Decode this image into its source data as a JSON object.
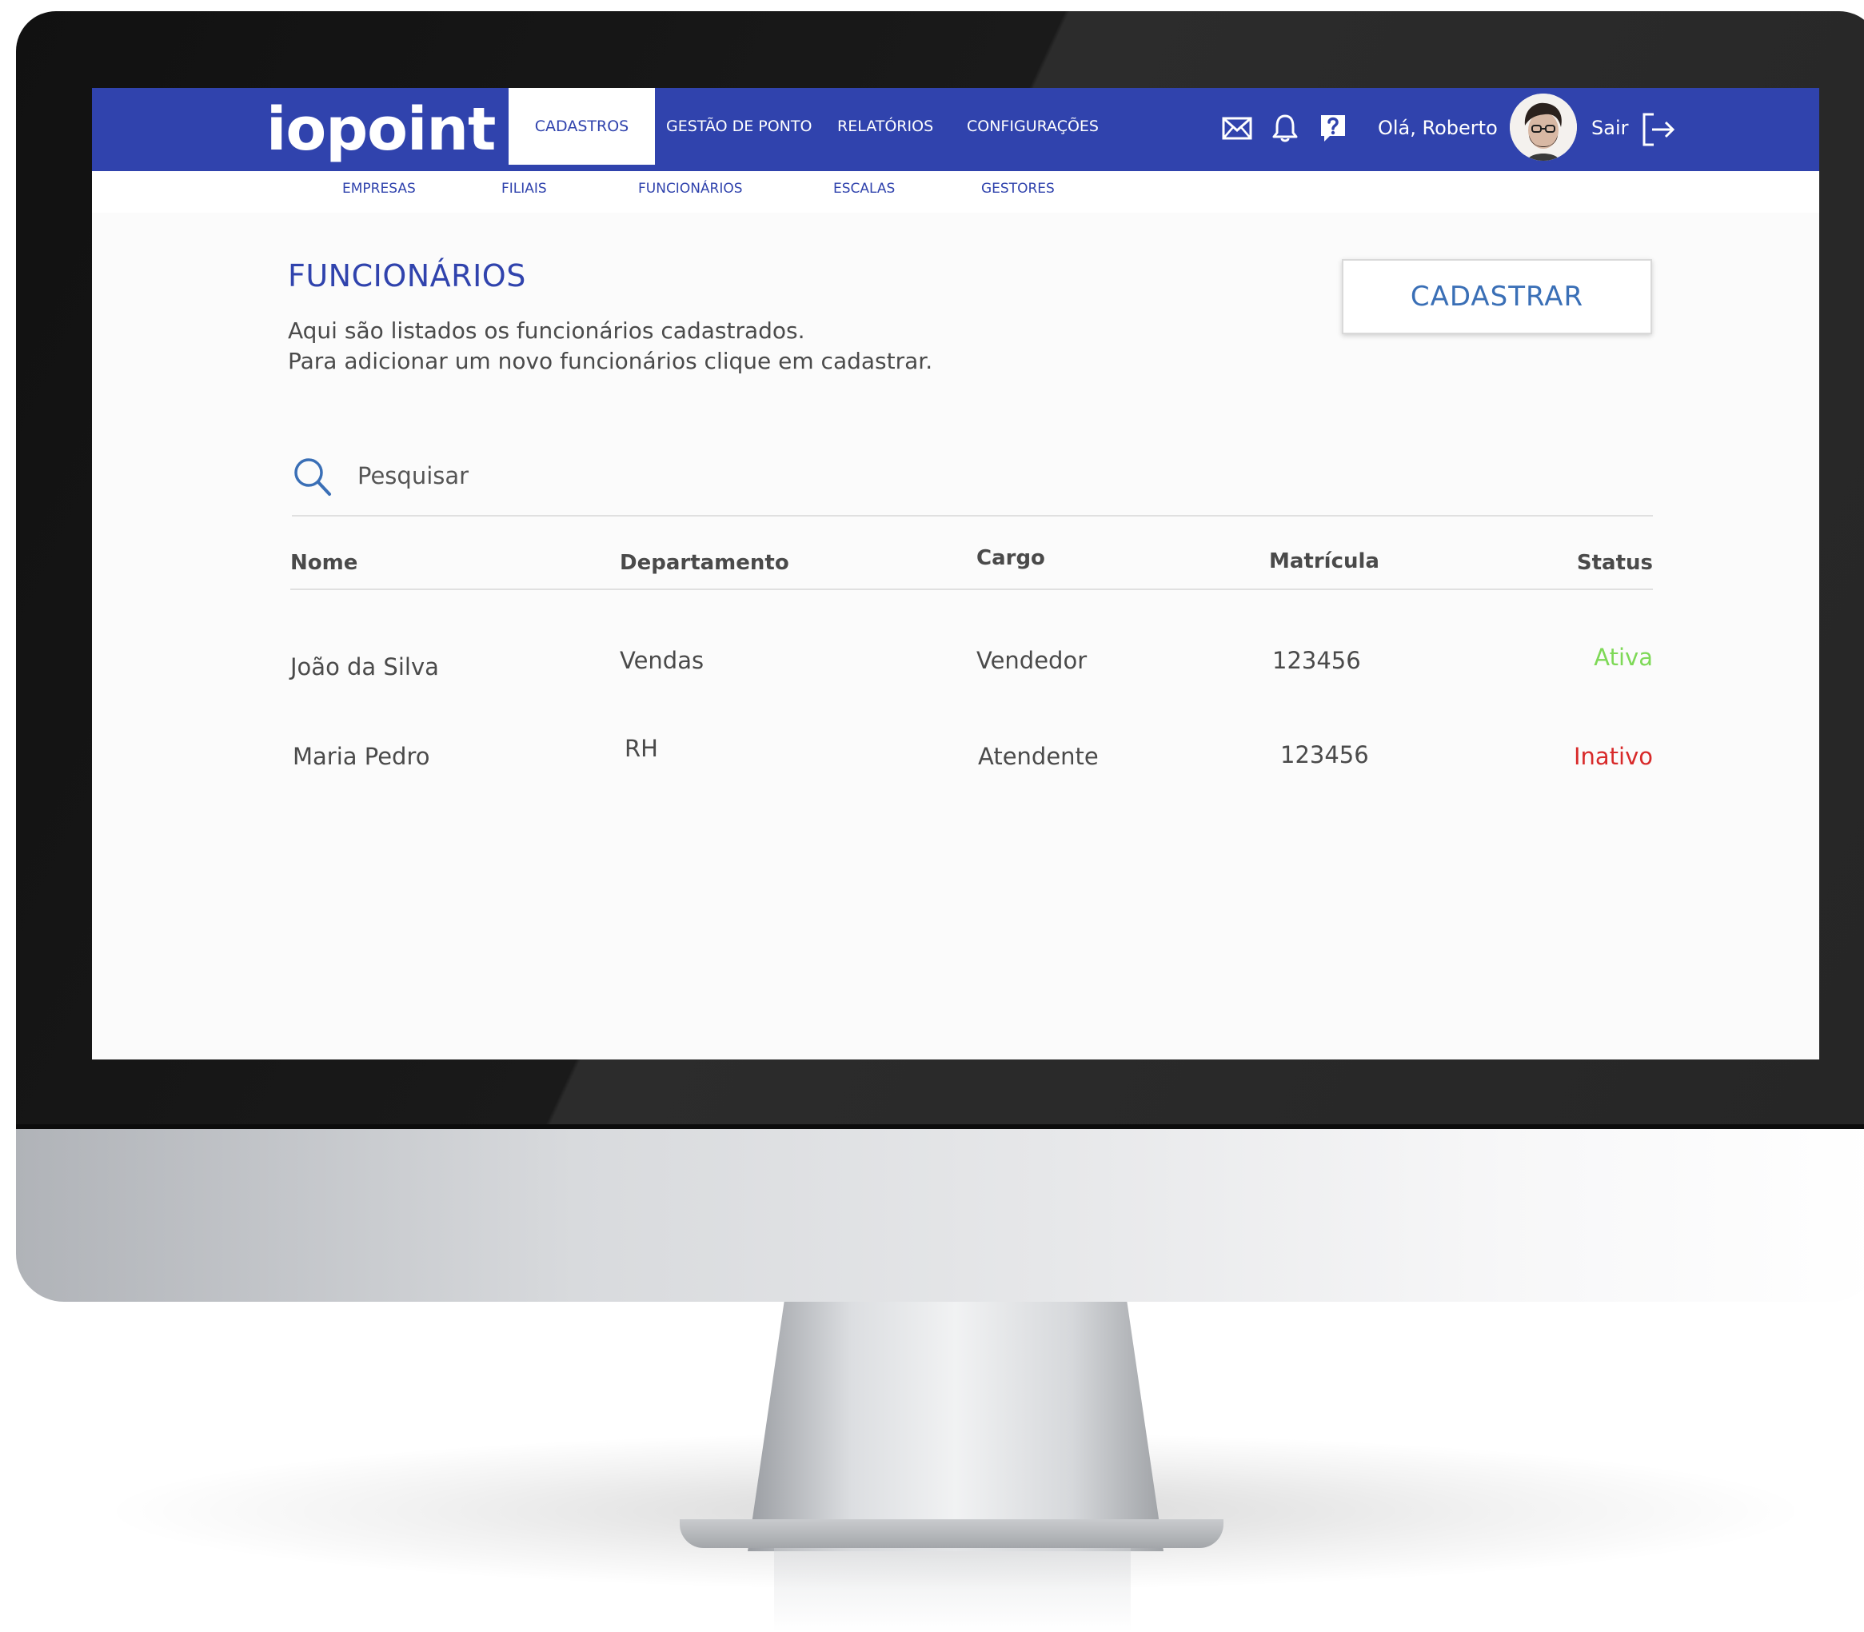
{
  "app": {
    "logo": "iopoint"
  },
  "nav": {
    "items": [
      {
        "label": "CADASTROS",
        "active": true
      },
      {
        "label": "GESTÃO DE PONTO",
        "active": false
      },
      {
        "label": "RELATÓRIOS",
        "active": false
      },
      {
        "label": "CONFIGURAÇÕES",
        "active": false
      }
    ]
  },
  "toolbar": {
    "icons": [
      "mail-icon",
      "bell-icon",
      "help-icon"
    ],
    "greeting": "Olá, Roberto",
    "logout_label": "Sair"
  },
  "subnav": {
    "items": [
      "EMPRESAS",
      "FILIAIS",
      "FUNCIONÁRIOS",
      "ESCALAS",
      "GESTORES"
    ]
  },
  "page": {
    "title": "FUNCIONÁRIOS",
    "description_line1": "Aqui são listados os funcionários cadastrados.",
    "description_line2": "Para adicionar um novo funcionários clique em cadastrar.",
    "add_button": "CADASTRAR"
  },
  "search": {
    "placeholder": "Pesquisar",
    "value": ""
  },
  "table": {
    "columns": [
      "Nome",
      "Departamento",
      "Cargo",
      "Matrícula",
      "Status"
    ],
    "rows": [
      {
        "nome": "João da Silva",
        "departamento": "Vendas",
        "cargo": "Vendedor",
        "matricula": "123456",
        "status": "Ativa"
      },
      {
        "nome": "Maria Pedro",
        "departamento": "RH",
        "cargo": "Atendente",
        "matricula": "123456",
        "status": "Inativo"
      }
    ]
  },
  "colors": {
    "brand": "#3043ad",
    "button_text": "#3a6fb6",
    "status_active": "#7ed957",
    "status_inactive": "#d82a2a"
  }
}
